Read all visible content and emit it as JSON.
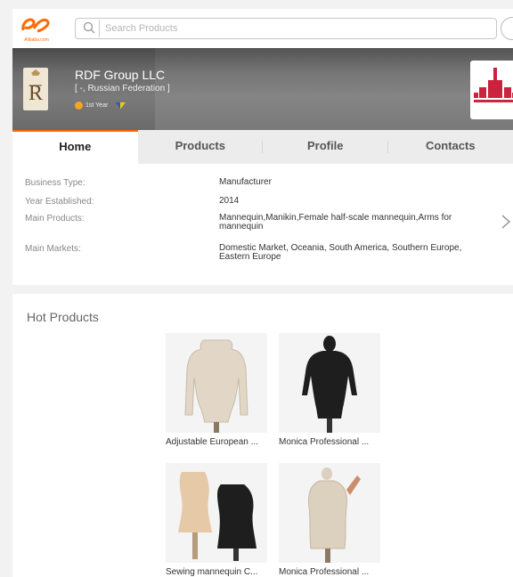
{
  "brand": {
    "logo_text": "Alibaba.com"
  },
  "search": {
    "placeholder": "Search Products"
  },
  "company": {
    "name": "RDF Group LLC",
    "location": "[ -, Russian Federation ]",
    "badge_text": "1st Year"
  },
  "tabs": [
    {
      "label": "Home",
      "active": true
    },
    {
      "label": "Products",
      "active": false
    },
    {
      "label": "Profile",
      "active": false
    },
    {
      "label": "Contacts",
      "active": false
    }
  ],
  "info": [
    {
      "label": "Business Type:",
      "value": "Manufacturer"
    },
    {
      "label": "Year Established:",
      "value": "2014"
    },
    {
      "label": "Main Products:",
      "value": "Mannequin,Manikin,Female half-scale mannequin,Arms for mannequin"
    },
    {
      "label": "Main Markets:",
      "value": "Domestic Market, Oceania, South America, Southern Europe, Eastern Europe"
    }
  ],
  "hot_products": {
    "title": "Hot Products",
    "items": [
      {
        "name": "Adjustable European ...",
        "color": "#e2d7c6"
      },
      {
        "name": "Monica Professional ...",
        "color": "#1e1e1e"
      },
      {
        "name": "Sewing mannequin C...",
        "color": "#e6c9a6"
      },
      {
        "name": "Monica Professional ...",
        "color": "#dcd0bf"
      }
    ]
  },
  "colors": {
    "accent": "#ff6a00",
    "banner": "#6c6c6c"
  }
}
